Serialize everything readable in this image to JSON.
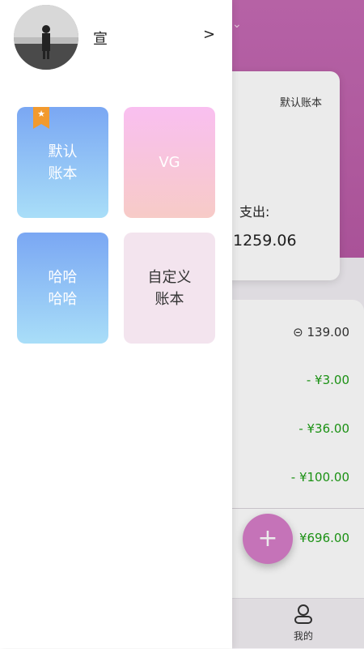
{
  "drawer": {
    "user_name": "宣",
    "books": [
      {
        "title": "默认\n账本"
      },
      {
        "title": "VG"
      },
      {
        "title": "哈哈\n哈哈"
      },
      {
        "title": "自定义\n账本"
      }
    ]
  },
  "background": {
    "book_name": "默认账本",
    "expense_label": "支出:",
    "expense_value": "1259.06",
    "amounts": [
      "⊝ 139.00",
      "- ¥3.00",
      "- ¥36.00",
      "- ¥100.00",
      "¥696.00"
    ],
    "fab_label": "+",
    "tab_mine_label": "我的"
  },
  "colors": {
    "header_purple": "#c66bb4",
    "book_blue_start": "#7aa7f3",
    "book_pink_start": "#f9bff0",
    "badge_orange": "#f29a2e",
    "amount_green": "#1e9e16"
  },
  "icons": {
    "avatar": "user-avatar",
    "chevron": "chevron-right-icon",
    "badge": "star-bookmark-icon",
    "tab": "person-icon"
  }
}
